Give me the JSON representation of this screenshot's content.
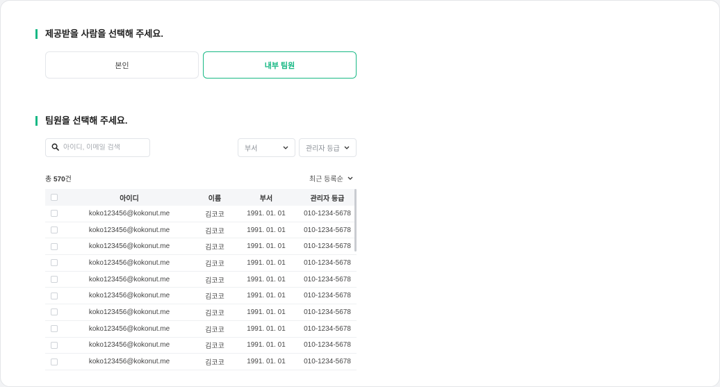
{
  "section1": {
    "title": "제공받을 사람을 선택해 주세요."
  },
  "choices": {
    "self": "본인",
    "team": "내부 팀원",
    "selected": "team"
  },
  "section2": {
    "title": "팀원을 선택해 주세요."
  },
  "search": {
    "placeholder": "아이디, 이메일 검색",
    "value": ""
  },
  "filters": {
    "dept": "부서",
    "grade": "관리자 등급"
  },
  "summary": {
    "prefix": "총",
    "count": "570",
    "suffix": "건"
  },
  "sort": {
    "label": "최근 등록순"
  },
  "table": {
    "headers": {
      "id": "아이디",
      "name": "이름",
      "dept": "부서",
      "grade": "관리자 등급"
    },
    "rows": [
      {
        "id": "koko123456@kokonut.me",
        "name": "김코코",
        "dept": "1991. 01. 01",
        "grade": "010-1234-5678"
      },
      {
        "id": "koko123456@kokonut.me",
        "name": "김코코",
        "dept": "1991. 01. 01",
        "grade": "010-1234-5678"
      },
      {
        "id": "koko123456@kokonut.me",
        "name": "김코코",
        "dept": "1991. 01. 01",
        "grade": "010-1234-5678"
      },
      {
        "id": "koko123456@kokonut.me",
        "name": "김코코",
        "dept": "1991. 01. 01",
        "grade": "010-1234-5678"
      },
      {
        "id": "koko123456@kokonut.me",
        "name": "김코코",
        "dept": "1991. 01. 01",
        "grade": "010-1234-5678"
      },
      {
        "id": "koko123456@kokonut.me",
        "name": "김코코",
        "dept": "1991. 01. 01",
        "grade": "010-1234-5678"
      },
      {
        "id": "koko123456@kokonut.me",
        "name": "김코코",
        "dept": "1991. 01. 01",
        "grade": "010-1234-5678"
      },
      {
        "id": "koko123456@kokonut.me",
        "name": "김코코",
        "dept": "1991. 01. 01",
        "grade": "010-1234-5678"
      },
      {
        "id": "koko123456@kokonut.me",
        "name": "김코코",
        "dept": "1991. 01. 01",
        "grade": "010-1234-5678"
      },
      {
        "id": "koko123456@kokonut.me",
        "name": "김코코",
        "dept": "1991. 01. 01",
        "grade": "010-1234-5678"
      }
    ]
  },
  "colors": {
    "accent": "#17b884",
    "border": "#e4e6ea",
    "header_bg": "#f5f6f8"
  },
  "icons": {
    "search": "search-icon",
    "dropdown": "chevron-down-icon",
    "checkbox": "checkbox-icon"
  }
}
